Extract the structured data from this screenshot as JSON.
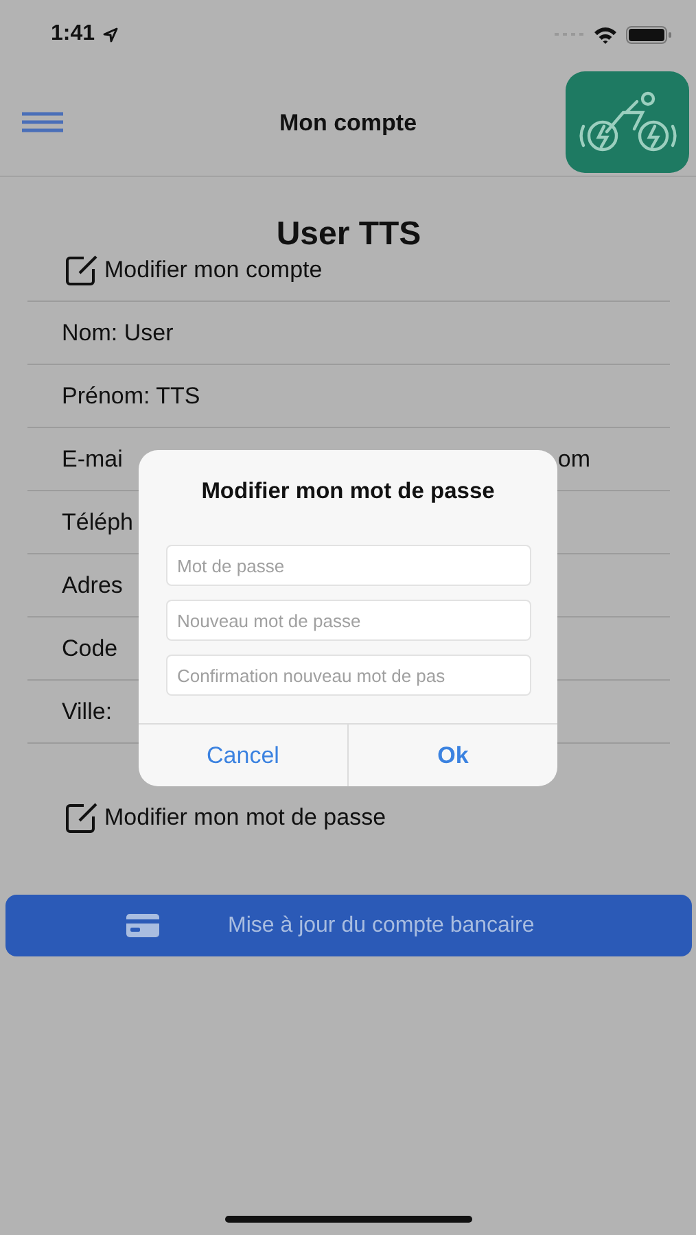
{
  "status_bar": {
    "time": "1:41"
  },
  "nav": {
    "title": "Mon compte"
  },
  "profile": {
    "name": "User TTS",
    "edit_account": "Modifier mon compte",
    "rows": [
      {
        "text": "Nom: User"
      },
      {
        "text": "Prénom: TTS"
      },
      {
        "text": "E-mai",
        "tail": "om"
      },
      {
        "text": "Téléph"
      },
      {
        "text": "Adres"
      },
      {
        "text": "Code"
      },
      {
        "text": "Ville:"
      }
    ],
    "edit_password": "Modifier mon mot de passe"
  },
  "bank_button": {
    "label": "Mise à jour du compte bancaire"
  },
  "dialog": {
    "title": "Modifier mon mot de passe",
    "fields": [
      {
        "placeholder": "Mot de passe"
      },
      {
        "placeholder": "Nouveau mot de passe"
      },
      {
        "placeholder": "Confirmation nouveau mot de pas"
      }
    ],
    "buttons": [
      {
        "label": "Cancel",
        "primary": false
      },
      {
        "label": "Ok",
        "primary": true
      }
    ]
  }
}
